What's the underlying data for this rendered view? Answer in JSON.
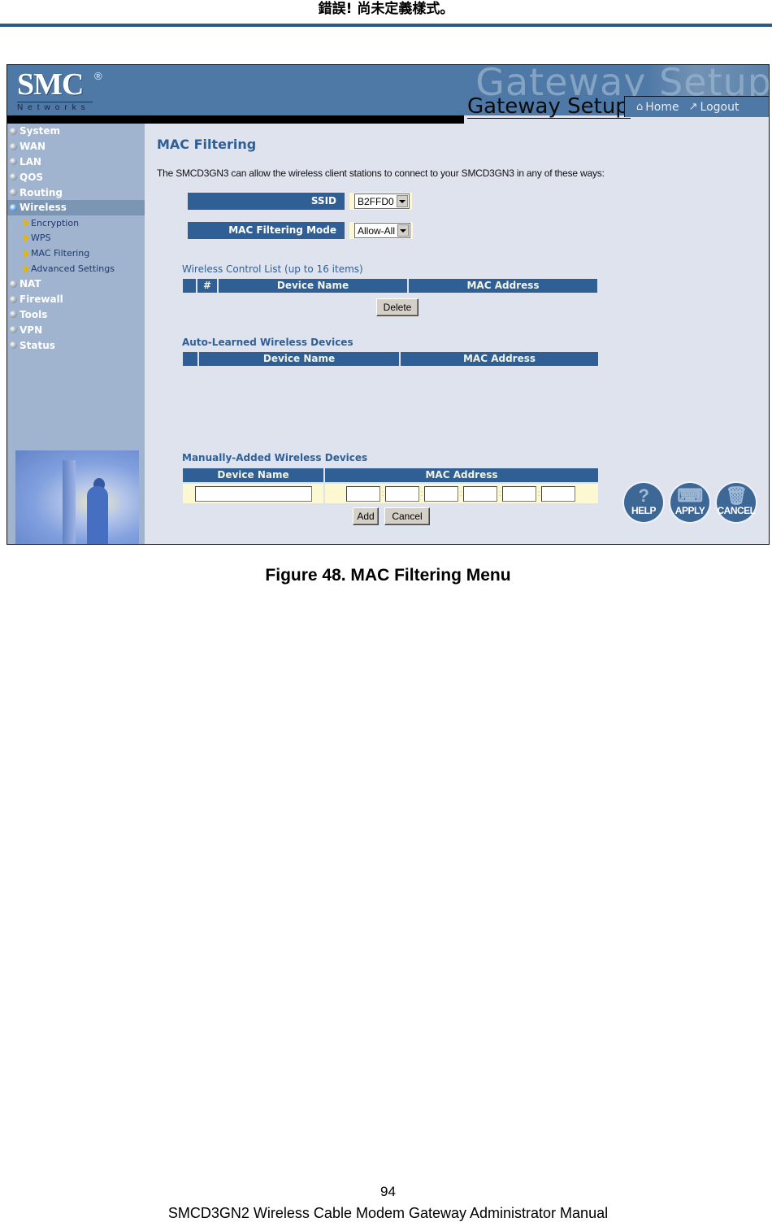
{
  "document": {
    "header": "錯誤! 尚未定義樣式。",
    "caption": "Figure 48. MAC Filtering Menu",
    "page_number": "94",
    "footer": "SMCD3GN2 Wireless Cable Modem Gateway Administrator Manual"
  },
  "app": {
    "logo": {
      "brand": "SMC",
      "registered": "®",
      "sub": "Networks"
    },
    "banner_ghost_text": "Gateway Setup",
    "title": "Gateway Setup",
    "top_links": [
      {
        "label": "Home",
        "icon": "home-icon"
      },
      {
        "label": "Logout",
        "icon": "logout-icon"
      }
    ],
    "sidebar": {
      "items": [
        {
          "label": "System"
        },
        {
          "label": "WAN"
        },
        {
          "label": "LAN"
        },
        {
          "label": "QOS"
        },
        {
          "label": "Routing"
        },
        {
          "label": "Wireless",
          "active": true,
          "children": [
            {
              "label": "Encryption"
            },
            {
              "label": "WPS"
            },
            {
              "label": "MAC Filtering"
            },
            {
              "label": "Advanced Settings"
            }
          ]
        },
        {
          "label": "NAT"
        },
        {
          "label": "Firewall"
        },
        {
          "label": "Tools"
        },
        {
          "label": "VPN"
        },
        {
          "label": "Status"
        }
      ]
    },
    "main": {
      "title": "MAC Filtering",
      "intro": "The SMCD3GN3 can allow the wireless client stations to connect to your SMCD3GN3 in any of these ways:",
      "ssid": {
        "label": "SSID",
        "value": "B2FFD0"
      },
      "mode": {
        "label": "MAC Filtering Mode",
        "value": "Allow-All"
      },
      "control_list": {
        "title": "Wireless Control List (up to 16 items)",
        "columns": [
          "",
          "#",
          "Device Name",
          "MAC Address"
        ],
        "rows": [],
        "delete_label": "Delete"
      },
      "auto_learned": {
        "title": "Auto-Learned Wireless Devices",
        "columns": [
          "",
          "Device Name",
          "MAC Address"
        ],
        "rows": []
      },
      "manual": {
        "title": "Manually-Added Wireless Devices",
        "columns": [
          "Device Name",
          "MAC Address"
        ],
        "device_name_value": "",
        "mac_octets": [
          "",
          "",
          "",
          "",
          "",
          ""
        ],
        "separator": ":",
        "add_label": "Add",
        "cancel_label": "Cancel"
      },
      "action_buttons": [
        {
          "label": "HELP",
          "icon": "help-icon"
        },
        {
          "label": "APPLY",
          "icon": "apply-icon"
        },
        {
          "label": "CANCEL",
          "icon": "cancel-icon"
        }
      ]
    }
  },
  "colors": {
    "accent": "#2f5f95",
    "banner": "#4e78a5",
    "sidebar": "#a0b3cf",
    "content_bg": "#dfe3ee",
    "input_row_bg": "#fcf8d2",
    "header_rule": "#2c5a85"
  }
}
